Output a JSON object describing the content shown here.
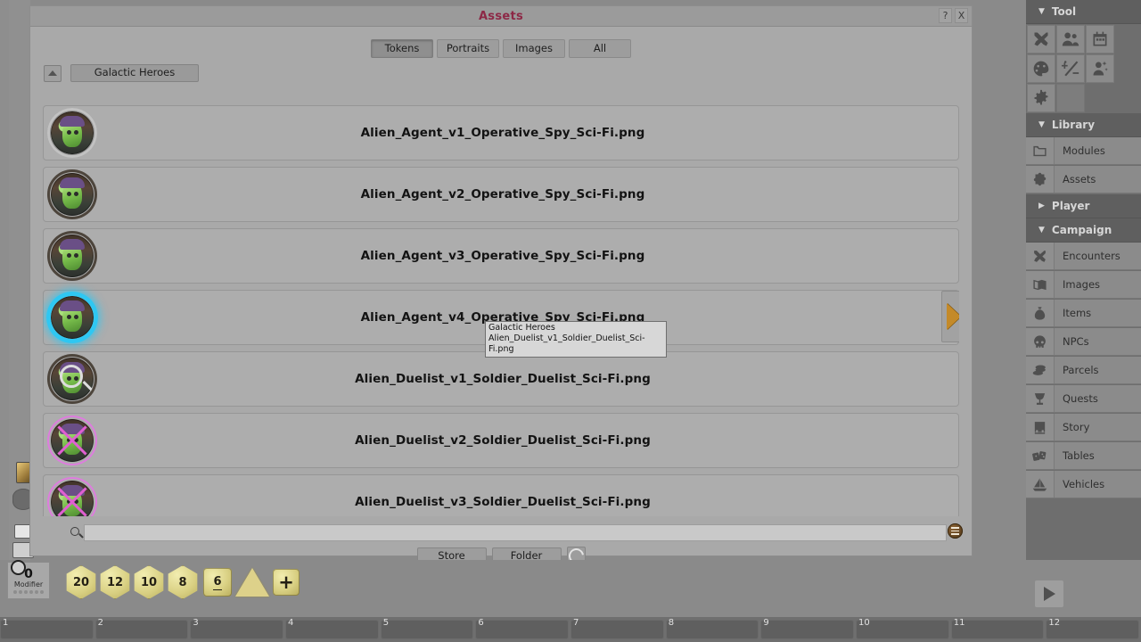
{
  "window": {
    "title": "Assets",
    "help_button": "?",
    "close_button": "X"
  },
  "filters": [
    {
      "label": "Tokens",
      "active": true
    },
    {
      "label": "Portraits",
      "active": false
    },
    {
      "label": "Images",
      "active": false
    },
    {
      "label": "All",
      "active": false
    }
  ],
  "breadcrumb": {
    "up_icon": "triangle-up-icon",
    "folder": "Galactic Heroes"
  },
  "assets": [
    {
      "name": "Alien_Agent_v1_Operative_Spy_Sci-Fi.png",
      "ring": "plain",
      "selected": false
    },
    {
      "name": "Alien_Agent_v2_Operative_Spy_Sci-Fi.png",
      "ring": "dark",
      "selected": false
    },
    {
      "name": "Alien_Agent_v3_Operative_Spy_Sci-Fi.png",
      "ring": "dark",
      "selected": false
    },
    {
      "name": "Alien_Agent_v4_Operative_Spy_Sci-Fi.png",
      "ring": "cyan",
      "selected": true
    },
    {
      "name": "Alien_Duelist_v1_Soldier_Duelist_Sci-Fi.png",
      "ring": "magnifier",
      "selected": false
    },
    {
      "name": "Alien_Duelist_v2_Soldier_Duelist_Sci-Fi.png",
      "ring": "magenta",
      "selected": false
    },
    {
      "name": "Alien_Duelist_v3_Soldier_Duelist_Sci-Fi.png",
      "ring": "magenta",
      "selected": false
    }
  ],
  "tooltip": {
    "line1": "Galactic Heroes",
    "line2": "Alien_Duelist_v1_Soldier_Duelist_Sci-Fi.png"
  },
  "list_arrow_icon": "triangle-right-icon",
  "search": {
    "icon": "search-icon",
    "value": "",
    "placeholder": "",
    "menu_icon": "hamburger-menu-icon"
  },
  "footer_buttons": {
    "store": "Store",
    "folder": "Folder",
    "refresh_icon": "refresh-icon"
  },
  "sidebar": {
    "tool": {
      "title": "Tool",
      "caret": "▼",
      "icons": [
        "crossed-swords-icon",
        "group-of-people-icon",
        "calendar-icon",
        "palette-icon",
        "plus-minus-icon",
        "person-sparkle-icon",
        "gear-icon"
      ]
    },
    "library": {
      "title": "Library",
      "caret": "▼",
      "items": [
        {
          "label": "Modules",
          "icon": "folder-icon"
        },
        {
          "label": "Assets",
          "icon": "puzzle-piece-icon"
        }
      ]
    },
    "player": {
      "title": "Player",
      "caret": "▶"
    },
    "campaign": {
      "title": "Campaign",
      "caret": "▼",
      "items": [
        {
          "label": "Encounters",
          "icon": "crossed-swords-icon"
        },
        {
          "label": "Images",
          "icon": "map-image-icon"
        },
        {
          "label": "Items",
          "icon": "money-bag-icon"
        },
        {
          "label": "NPCs",
          "icon": "skull-icon"
        },
        {
          "label": "Parcels",
          "icon": "coins-icon"
        },
        {
          "label": "Quests",
          "icon": "goblet-icon"
        },
        {
          "label": "Story",
          "icon": "book-icon"
        },
        {
          "label": "Tables",
          "icon": "dice-cards-icon"
        },
        {
          "label": "Vehicles",
          "icon": "sailboat-icon"
        }
      ]
    }
  },
  "dice_bar": {
    "modifier": {
      "value": "0",
      "label": "Modifier",
      "gear_icon": "gear-icon",
      "dots": 6
    },
    "dice": [
      {
        "label": "20",
        "shape": "poly"
      },
      {
        "label": "12",
        "shape": "poly"
      },
      {
        "label": "10",
        "shape": "poly"
      },
      {
        "label": "8",
        "shape": "poly"
      },
      {
        "label": "6",
        "shape": "d6"
      },
      {
        "label": "",
        "shape": "d4"
      },
      {
        "label": "+",
        "shape": "plus"
      }
    ],
    "play_icon": "play-icon"
  },
  "timeline": {
    "slots": [
      "1",
      "2",
      "3",
      "4",
      "5",
      "6",
      "7",
      "8",
      "9",
      "10",
      "11",
      "12"
    ]
  }
}
